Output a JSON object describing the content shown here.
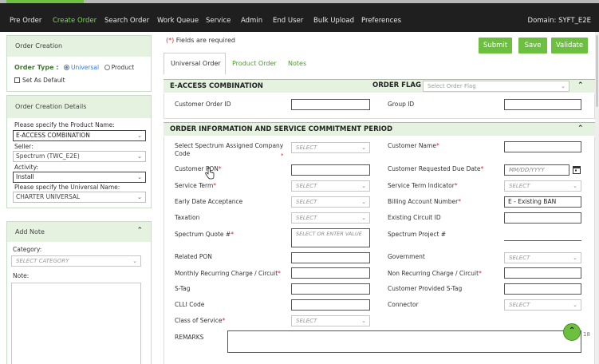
{
  "nav": {
    "items": [
      "Pre Order",
      "Create Order",
      "Search Order",
      "Work Queue",
      "Service",
      "Admin",
      "End User",
      "Bulk Upload",
      "Preferences"
    ],
    "domain": "Domain: SYFT_E2E"
  },
  "left": {
    "creation_title": "Order Creation",
    "order_type_label": "Order Type :",
    "order_type_options": [
      "Universal",
      "Product"
    ],
    "set_default": "Set As Default",
    "details_title": "Order Creation Details",
    "product_name_label": "Please specify the Product Name:",
    "product_name_value": "E-ACCESS COMBINATION",
    "seller_label": "Seller:",
    "seller_value": "Spectrum (TWC_E2E)",
    "activity_label": "Activity:",
    "activity_value": "Install",
    "universal_name_label": "Please specify the Universal Name:",
    "universal_name_value": "CHARTER UNIVERSAL",
    "add_note_title": "Add Note",
    "category_label": "Category:",
    "category_placeholder": "SELECT CATEGORY",
    "note_label": "Note:"
  },
  "main": {
    "required_marker": "(*)",
    "required_text": " Fields are required",
    "buttons": {
      "submit": "Submit",
      "save": "Save",
      "validate": "Validate"
    },
    "tabs": [
      "Universal Order",
      "Product Order",
      "Notes"
    ],
    "sec1": {
      "title": "E-ACCESS COMBINATION",
      "flag_label": "ORDER FLAG",
      "flag_placeholder": "Select Order Flag",
      "customer_order_id": "Customer Order ID",
      "group_id": "Group ID"
    },
    "sec2": {
      "title": "ORDER INFORMATION AND SERVICE COMMITMENT PERIOD",
      "select": "SELECT",
      "select_or_enter": "SELECT OR ENTER VALUE",
      "date_placeholder": "MM/DD/YYYY",
      "ban_value": "E - Existing BAN",
      "remarks_counter": "18",
      "left_fields": [
        {
          "label": "Select Spectrum Assigned Company Code",
          "req": false
        },
        {
          "label": "Customer PON",
          "req": true
        },
        {
          "label": "Service Term",
          "req": true
        },
        {
          "label": "Early Date Acceptance",
          "req": false
        },
        {
          "label": "Taxation",
          "req": false
        },
        {
          "label": "Spectrum Quote #",
          "req": true
        },
        {
          "label": "Related PON",
          "req": false
        },
        {
          "label": "Monthly Recurring Charge / Circuit",
          "req": true
        },
        {
          "label": "S-Tag",
          "req": false
        },
        {
          "label": "CLLI Code",
          "req": false
        },
        {
          "label": "Class of Service",
          "req": true
        },
        {
          "label": "REMARKS",
          "req": false
        }
      ],
      "right_fields": [
        {
          "label": "Customer Name",
          "req": true
        },
        {
          "label": "Customer Requested Due Date",
          "req": true
        },
        {
          "label": "Service Term Indicator",
          "req": true
        },
        {
          "label": "Billing Account Number",
          "req": true
        },
        {
          "label": "Existing Circuit ID",
          "req": false
        },
        {
          "label": "Spectrum Project #",
          "req": false
        },
        {
          "label": "Government",
          "req": false
        },
        {
          "label": "Non Recurring Charge / Circuit",
          "req": true
        },
        {
          "label": "Customer Provided S-Tag",
          "req": false
        },
        {
          "label": "Connector",
          "req": false
        }
      ]
    }
  },
  "colors": {
    "accent": "#6cbf3f",
    "nav_bg": "#1f1f1f",
    "section_bg": "#e5f2e0",
    "required": "#d9262b"
  }
}
